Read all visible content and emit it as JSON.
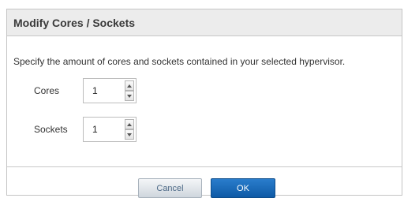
{
  "dialog": {
    "title": "Modify Cores / Sockets",
    "description": "Specify the amount of cores and sockets contained in your selected hypervisor.",
    "fields": [
      {
        "label": "Cores",
        "value": "1"
      },
      {
        "label": "Sockets",
        "value": "1"
      }
    ],
    "buttons": {
      "cancel": "Cancel",
      "ok": "OK"
    }
  },
  "colors": {
    "header_bg": "#ececec",
    "ok_button": "#1565b8",
    "cancel_text": "#4f6b88"
  }
}
